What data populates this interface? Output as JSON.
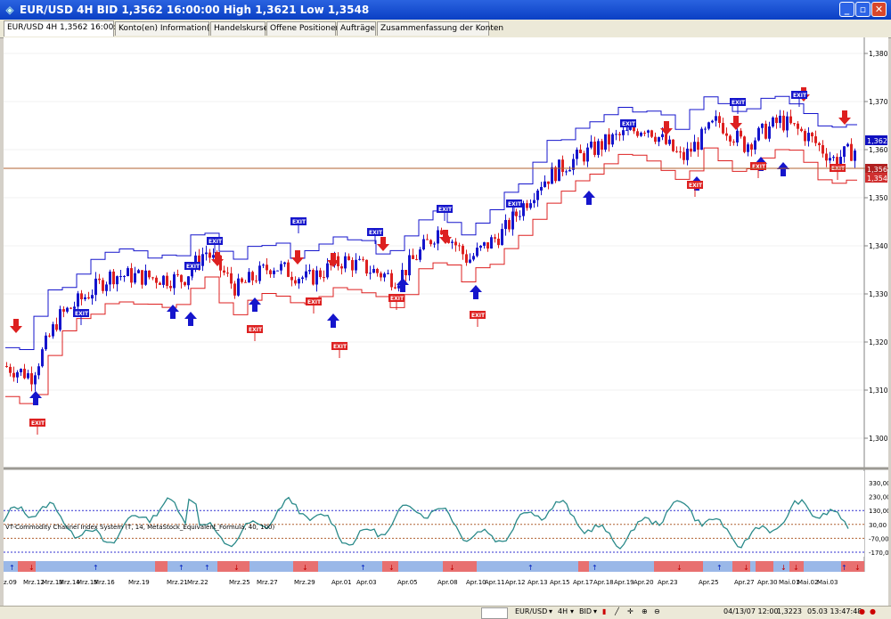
{
  "window": {
    "title": "EUR/USD 4H BID 1,3562 16:00:00 High 1,3621 Low 1,3548"
  },
  "tabs": [
    {
      "label": "EUR/USD 4H 1,3562 16:00:00",
      "active": true
    },
    {
      "label": "Konto(en) Information(en)"
    },
    {
      "label": "Handelskurse"
    },
    {
      "label": "Offene Positionen"
    },
    {
      "label": "Aufträge"
    },
    {
      "label": "Zusammenfassung der Konten"
    }
  ],
  "price_axis": [
    "1,3800",
    "1,3700",
    "1,3600",
    "1,3500",
    "1,3400",
    "1,3300",
    "1,3200",
    "1,3100",
    "1,3000"
  ],
  "price_markers": {
    "high": "1,3621",
    "bid": "1,3562",
    "low": "1,3548"
  },
  "indicator": {
    "label": "VT-Commodity Channel Index System (T, 14, MetaStock_Equivalent_Formula, 40, 100)",
    "axis": [
      "330,00",
      "230,00",
      "130,00",
      "30,00",
      "-70,00",
      "-170,00"
    ]
  },
  "date_axis": [
    "z.09",
    "Mrz.12",
    "Mrz.13",
    "Mrz.14",
    "Mrz.15",
    "Mrz.16",
    "Mrz.19",
    "Mrz.21",
    "Mrz.22",
    "Mrz.25",
    "Mrz.27",
    "Mrz.29",
    "Apr.01",
    "Apr.03",
    "Apr.05",
    "Apr.08",
    "Apr.10",
    "Apr.11",
    "Apr.12",
    "Apr.13",
    "Apr.15",
    "Apr.17",
    "Apr.18",
    "Apr.19",
    "Apr.20",
    "Apr.23",
    "Apr.25",
    "Apr.27",
    "Apr.30",
    "Mai.01",
    "Mai.02",
    "Mai.03"
  ],
  "exit_label": "EXIT",
  "toolbar": {
    "symbol": "EUR/USD",
    "timeframe": "4H",
    "side": "BID"
  },
  "status": {
    "datetime": "04/13/07 12:00",
    "value": "1,3223",
    "clock": "05.03 13:47:48"
  },
  "colors": {
    "bull": "#1515cc",
    "bear": "#dd2020",
    "cci": "#2a8a8a",
    "level": "#b06030"
  }
}
